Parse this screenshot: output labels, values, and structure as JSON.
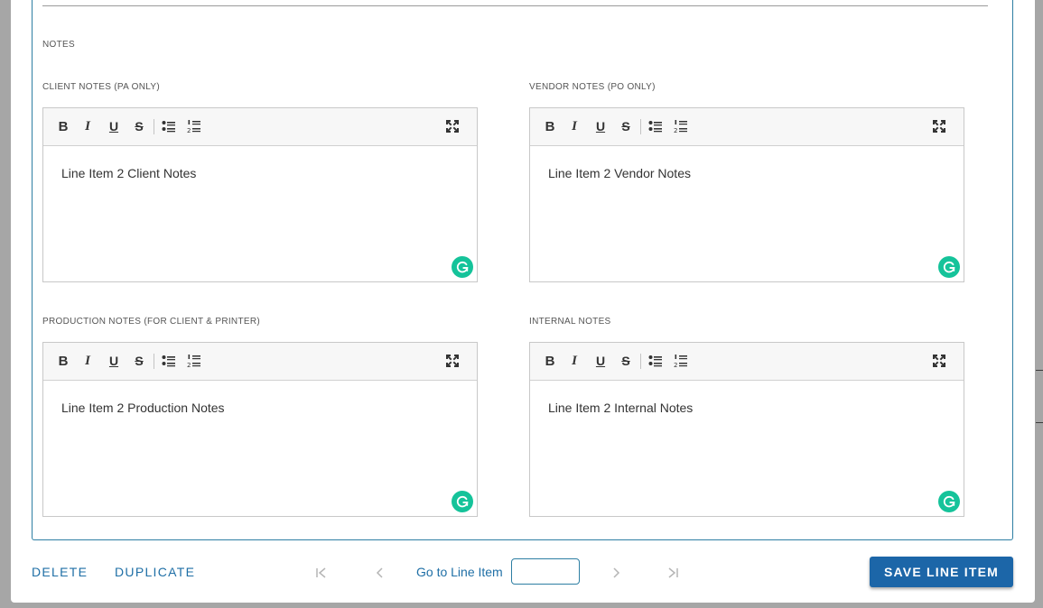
{
  "notes_section": {
    "title": "NOTES",
    "client_notes": {
      "label": "CLIENT NOTES (PA ONLY)",
      "content": "Line Item 2 Client Notes"
    },
    "vendor_notes": {
      "label": "VENDOR NOTES (PO ONLY)",
      "content": "Line Item 2 Vendor Notes"
    },
    "production_notes": {
      "label": "PRODUCTION NOTES (FOR CLIENT & PRINTER)",
      "content": "Line Item 2 Production Notes"
    },
    "internal_notes": {
      "label": "INTERNAL NOTES",
      "content": "Line Item 2 Internal Notes"
    }
  },
  "toolbar": {
    "bold": "B",
    "italic": "I",
    "underline": "U",
    "strikethrough": "S",
    "icons": [
      "bullet-list-icon",
      "numbered-list-icon",
      "fullscreen-icon"
    ]
  },
  "footer": {
    "delete_label": "DELETE",
    "duplicate_label": "DUPLICATE",
    "goto_label": "Go to Line Item",
    "goto_value": "",
    "save_label": "SAVE LINE ITEM",
    "nav_icons": [
      "first-page-icon",
      "previous-icon",
      "next-icon",
      "last-page-icon"
    ]
  },
  "colors": {
    "accent": "#1c66a8",
    "link": "#1f6fa6",
    "border_accent": "#2d7ea3",
    "grammarly": "#15c39a"
  }
}
